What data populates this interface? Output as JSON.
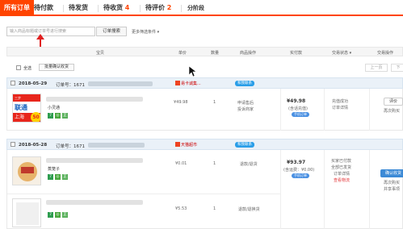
{
  "tabs": [
    {
      "label": "所有订单",
      "count": ""
    },
    {
      "label": "待付款",
      "count": ""
    },
    {
      "label": "待发货",
      "count": ""
    },
    {
      "label": "待收货",
      "count": "4"
    },
    {
      "label": "待评价",
      "count": "2"
    },
    {
      "label": "分阶段",
      "count": ""
    }
  ],
  "search": {
    "placeholder": "输入商品标题或订单号进行搜索",
    "button": "订单搜索",
    "more": "更多筛选条件 ▾"
  },
  "table_header": [
    "宝贝",
    "单价",
    "数量",
    "商品操作",
    "实付款",
    "交易状态 ▾",
    "交易操作"
  ],
  "toolbar": {
    "select_all": "全选",
    "batch_confirm": "批量确认收货",
    "prev": "上一页",
    "next": "下"
  },
  "orders": [
    {
      "date": "2018-05-29",
      "order_no_label": "订单号：1671",
      "shop": "易卡诚集...",
      "contact": "和我联系",
      "product_name": "小灵通",
      "thumb_text_top": "三步",
      "thumb_text_main": "联通",
      "thumb_text_sub": "上海",
      "thumb_number": "50",
      "price": "¥49.98",
      "qty": "1",
      "ops": [
        "申请售后",
        "投诉商家"
      ],
      "paid": "¥49.98",
      "paid_note": "(含话充值)",
      "paid_pill": "手机订单",
      "status": [
        "充值成功",
        "订单详情"
      ],
      "actions": [
        "评价",
        "再次购买"
      ]
    },
    {
      "date": "2018-05-28",
      "order_no_label": "订单号：1671",
      "shop": "天猫超市",
      "contact": "和我联系",
      "product_name": "蒸笼子",
      "price": "¥0.01",
      "qty": "1",
      "ops": [
        "退款/退货"
      ],
      "paid": "¥93.97",
      "paid_note": "(含运费：¥0.00)",
      "paid_pill": "手机订单",
      "status": [
        "买家已付款",
        "全部已发货",
        "订单详情",
        "查看物流"
      ],
      "actions": [
        "确认收货",
        "再次购买",
        "并享事项"
      ]
    },
    {
      "price": "¥5.53",
      "qty": "1",
      "ops": [
        "退款/退换货"
      ]
    }
  ]
}
